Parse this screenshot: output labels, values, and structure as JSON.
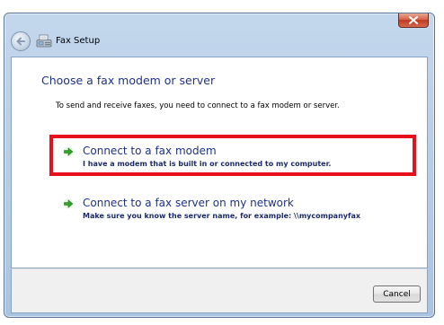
{
  "window": {
    "title": "Fax Setup",
    "close_icon": "close-icon",
    "back_icon": "back-arrow-icon",
    "app_icon": "fax-icon"
  },
  "main": {
    "heading": "Choose a fax modem or server",
    "instruction": "To send and receive faxes, you need to connect to a fax modem or server.",
    "options": [
      {
        "title": "Connect to a fax modem",
        "description": "I have a modem that is built in or connected to my computer.",
        "icon": "green-arrow-icon",
        "highlighted": true
      },
      {
        "title": "Connect to a fax server on my network",
        "description": "Make sure you know the server name, for example: \\\\mycompanyfax",
        "icon": "green-arrow-icon",
        "highlighted": false
      }
    ]
  },
  "footer": {
    "cancel_label": "Cancel"
  },
  "colors": {
    "heading": "#1e3287",
    "highlight": "#e8101a",
    "arrow": "#2fa52a"
  }
}
